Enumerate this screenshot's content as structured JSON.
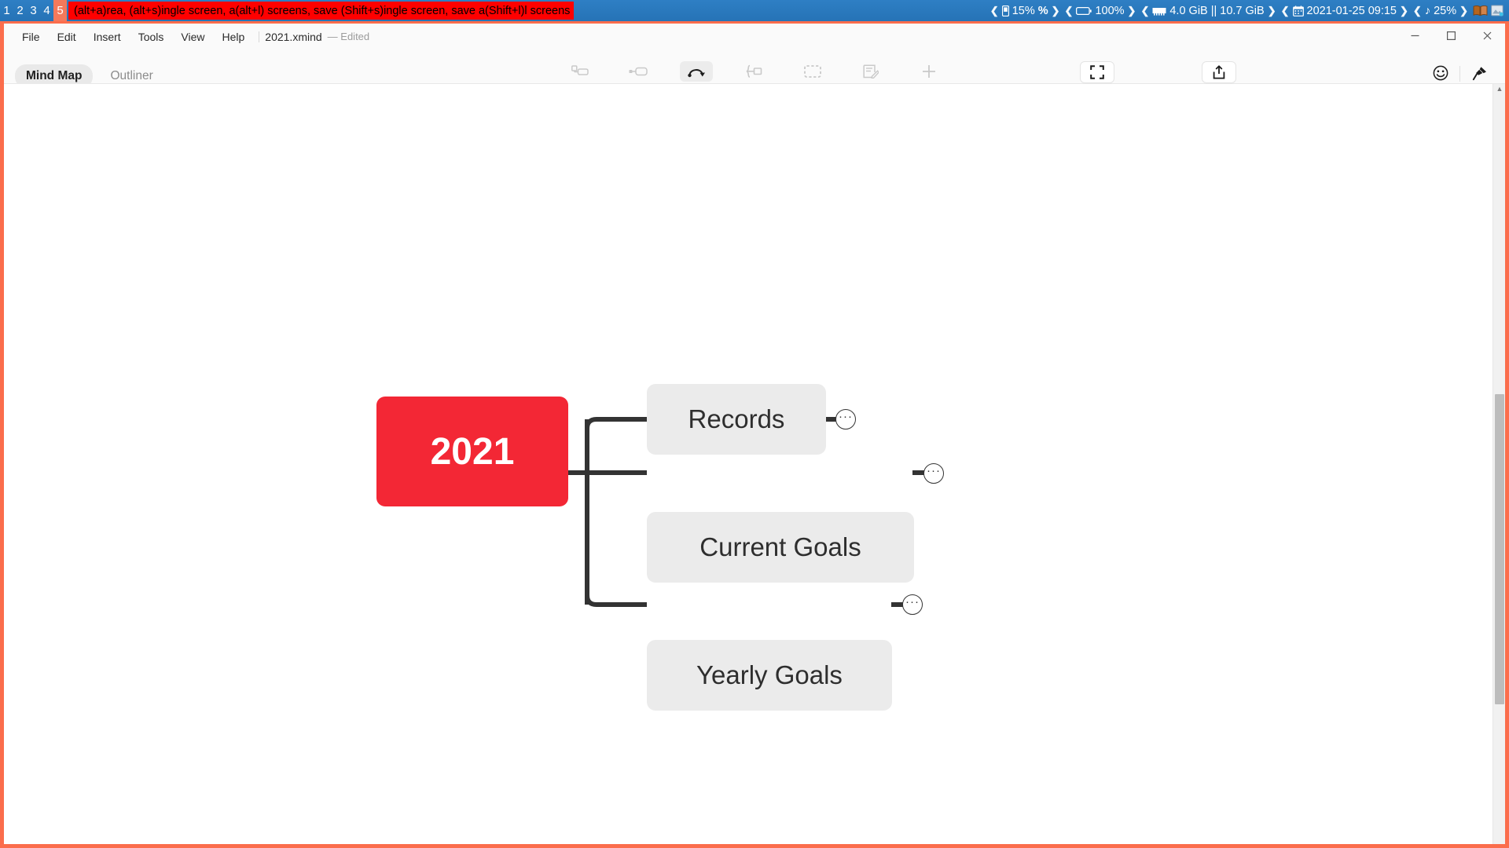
{
  "osbar": {
    "workspaces": [
      "1",
      "2",
      "3",
      "4",
      "5"
    ],
    "active_workspace": "5",
    "window_title": "(alt+a)rea, (alt+s)ingle screen, a(alt+l) screens, save (Shift+s)ingle screen, save a(Shift+l)l screens",
    "title_bg": "#ff0000",
    "tray": {
      "cpu": {
        "icon": "cpu-icon",
        "value": "15%",
        "suffix": "%"
      },
      "battery": {
        "icon": "battery-icon",
        "value": "100%"
      },
      "memory": {
        "icon": "memory-icon",
        "used": "4.0 GiB",
        "sep": "||",
        "total": "10.7 GiB"
      },
      "clock": {
        "icon": "calendar-icon",
        "value": "2021-01-25 09:15"
      },
      "volume": {
        "icon": "note-icon",
        "value": "25%"
      },
      "apps": [
        "book-icon",
        "picture-icon"
      ]
    }
  },
  "window": {
    "controls": {
      "minimize": "—",
      "maximize": "☐",
      "close": "✕"
    }
  },
  "menubar": {
    "items": [
      "File",
      "Edit",
      "Insert",
      "Tools",
      "View",
      "Help"
    ],
    "document_name": "2021.xmind",
    "document_status": "— Edited"
  },
  "viewtabs": {
    "items": [
      {
        "label": "Mind Map",
        "active": true
      },
      {
        "label": "Outliner",
        "active": false
      }
    ]
  },
  "toolbar": {
    "tools": [
      {
        "label": "Topic",
        "icon": "topic-icon",
        "state": "disabled"
      },
      {
        "label": "Subtopic",
        "icon": "subtopic-icon",
        "state": "disabled"
      },
      {
        "label": "Relationship",
        "icon": "relationship-icon",
        "state": "active"
      },
      {
        "label": "Summary",
        "icon": "summary-icon",
        "state": "disabled"
      },
      {
        "label": "Boundary",
        "icon": "boundary-icon",
        "state": "disabled"
      },
      {
        "label": "Note",
        "icon": "note-edit-icon",
        "state": "disabled"
      },
      {
        "label": "Insert",
        "icon": "plus-icon",
        "state": "disabled"
      }
    ],
    "zen": {
      "label": "ZEN",
      "icon": "fullscreen-icon"
    },
    "share": {
      "label": "Share",
      "icon": "share-upload-icon"
    },
    "right": [
      {
        "label": "Icon",
        "icon": "smiley-icon"
      },
      {
        "label": "Format",
        "icon": "brush-pin-icon"
      }
    ]
  },
  "mindmap": {
    "root": {
      "text": "2021",
      "color": "#f32735",
      "text_color": "#ffffff"
    },
    "children": [
      {
        "text": "Records",
        "expander": "···"
      },
      {
        "text": "Current Goals",
        "expander": "···"
      },
      {
        "text": "Yearly Goals",
        "expander": "···"
      }
    ],
    "node_color": "#ebebeb",
    "line_color": "#333333"
  },
  "scrollbar": {
    "arrow": "▲"
  }
}
